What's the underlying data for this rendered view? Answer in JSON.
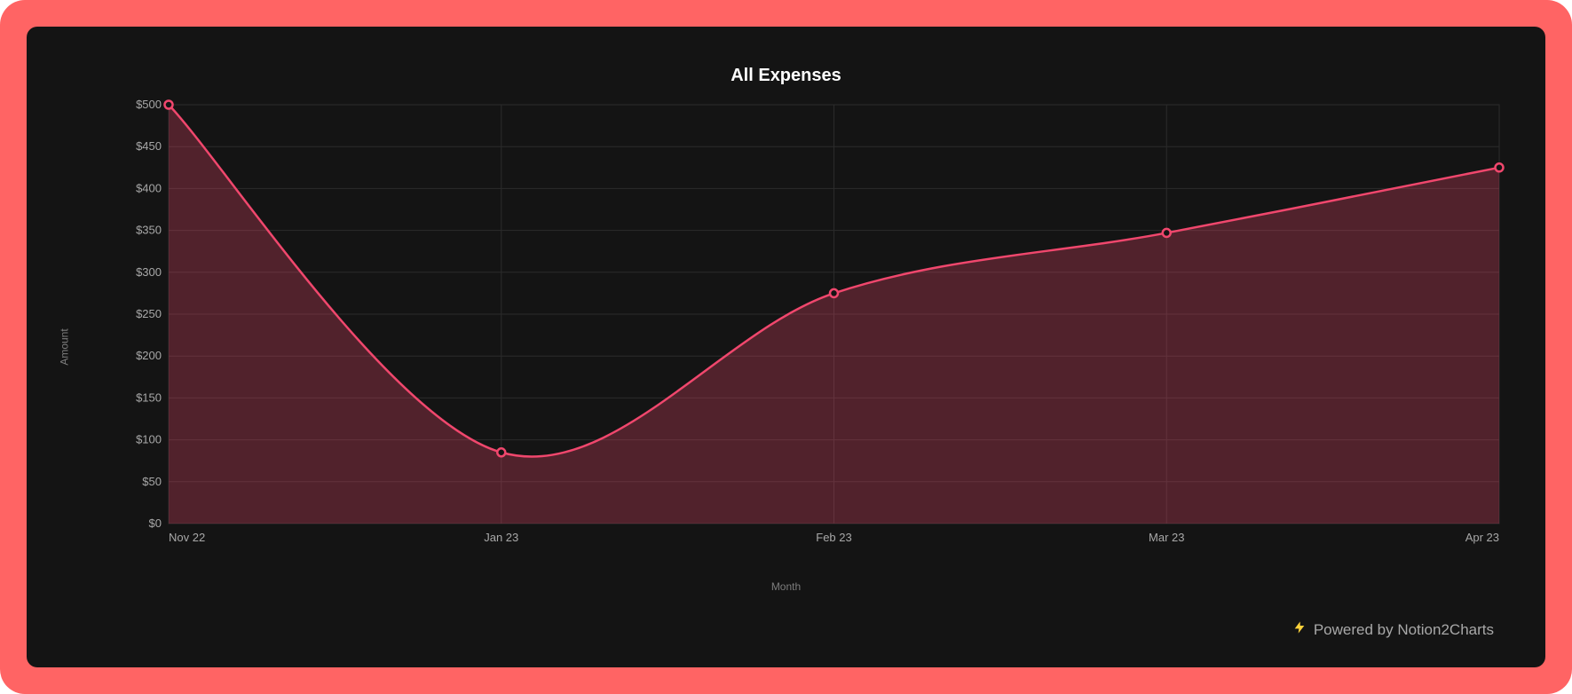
{
  "colors": {
    "outer_bg": "#ff6464",
    "panel_bg": "#141414",
    "grid": "#2b2b2b",
    "series": "#f0476d",
    "bolt": "#ffd23a"
  },
  "footer": {
    "text": "Powered by Notion2Charts"
  },
  "chart_data": {
    "type": "area",
    "title": "All Expenses",
    "xlabel": "Month",
    "ylabel": "Amount",
    "ylim": [
      0,
      500
    ],
    "y_ticks": [
      0,
      50,
      100,
      150,
      200,
      250,
      300,
      350,
      400,
      450,
      500
    ],
    "y_tick_labels": [
      "$0",
      "$50",
      "$100",
      "$150",
      "$200",
      "$250",
      "$300",
      "$350",
      "$400",
      "$450",
      "$500"
    ],
    "categories": [
      "Nov 22",
      "Jan 23",
      "Feb 23",
      "Mar 23",
      "Apr 23"
    ],
    "x_positions": [
      0,
      0.25,
      0.5,
      0.75,
      1.0
    ],
    "values": [
      500,
      85,
      275,
      347,
      425
    ],
    "smooth": true
  }
}
